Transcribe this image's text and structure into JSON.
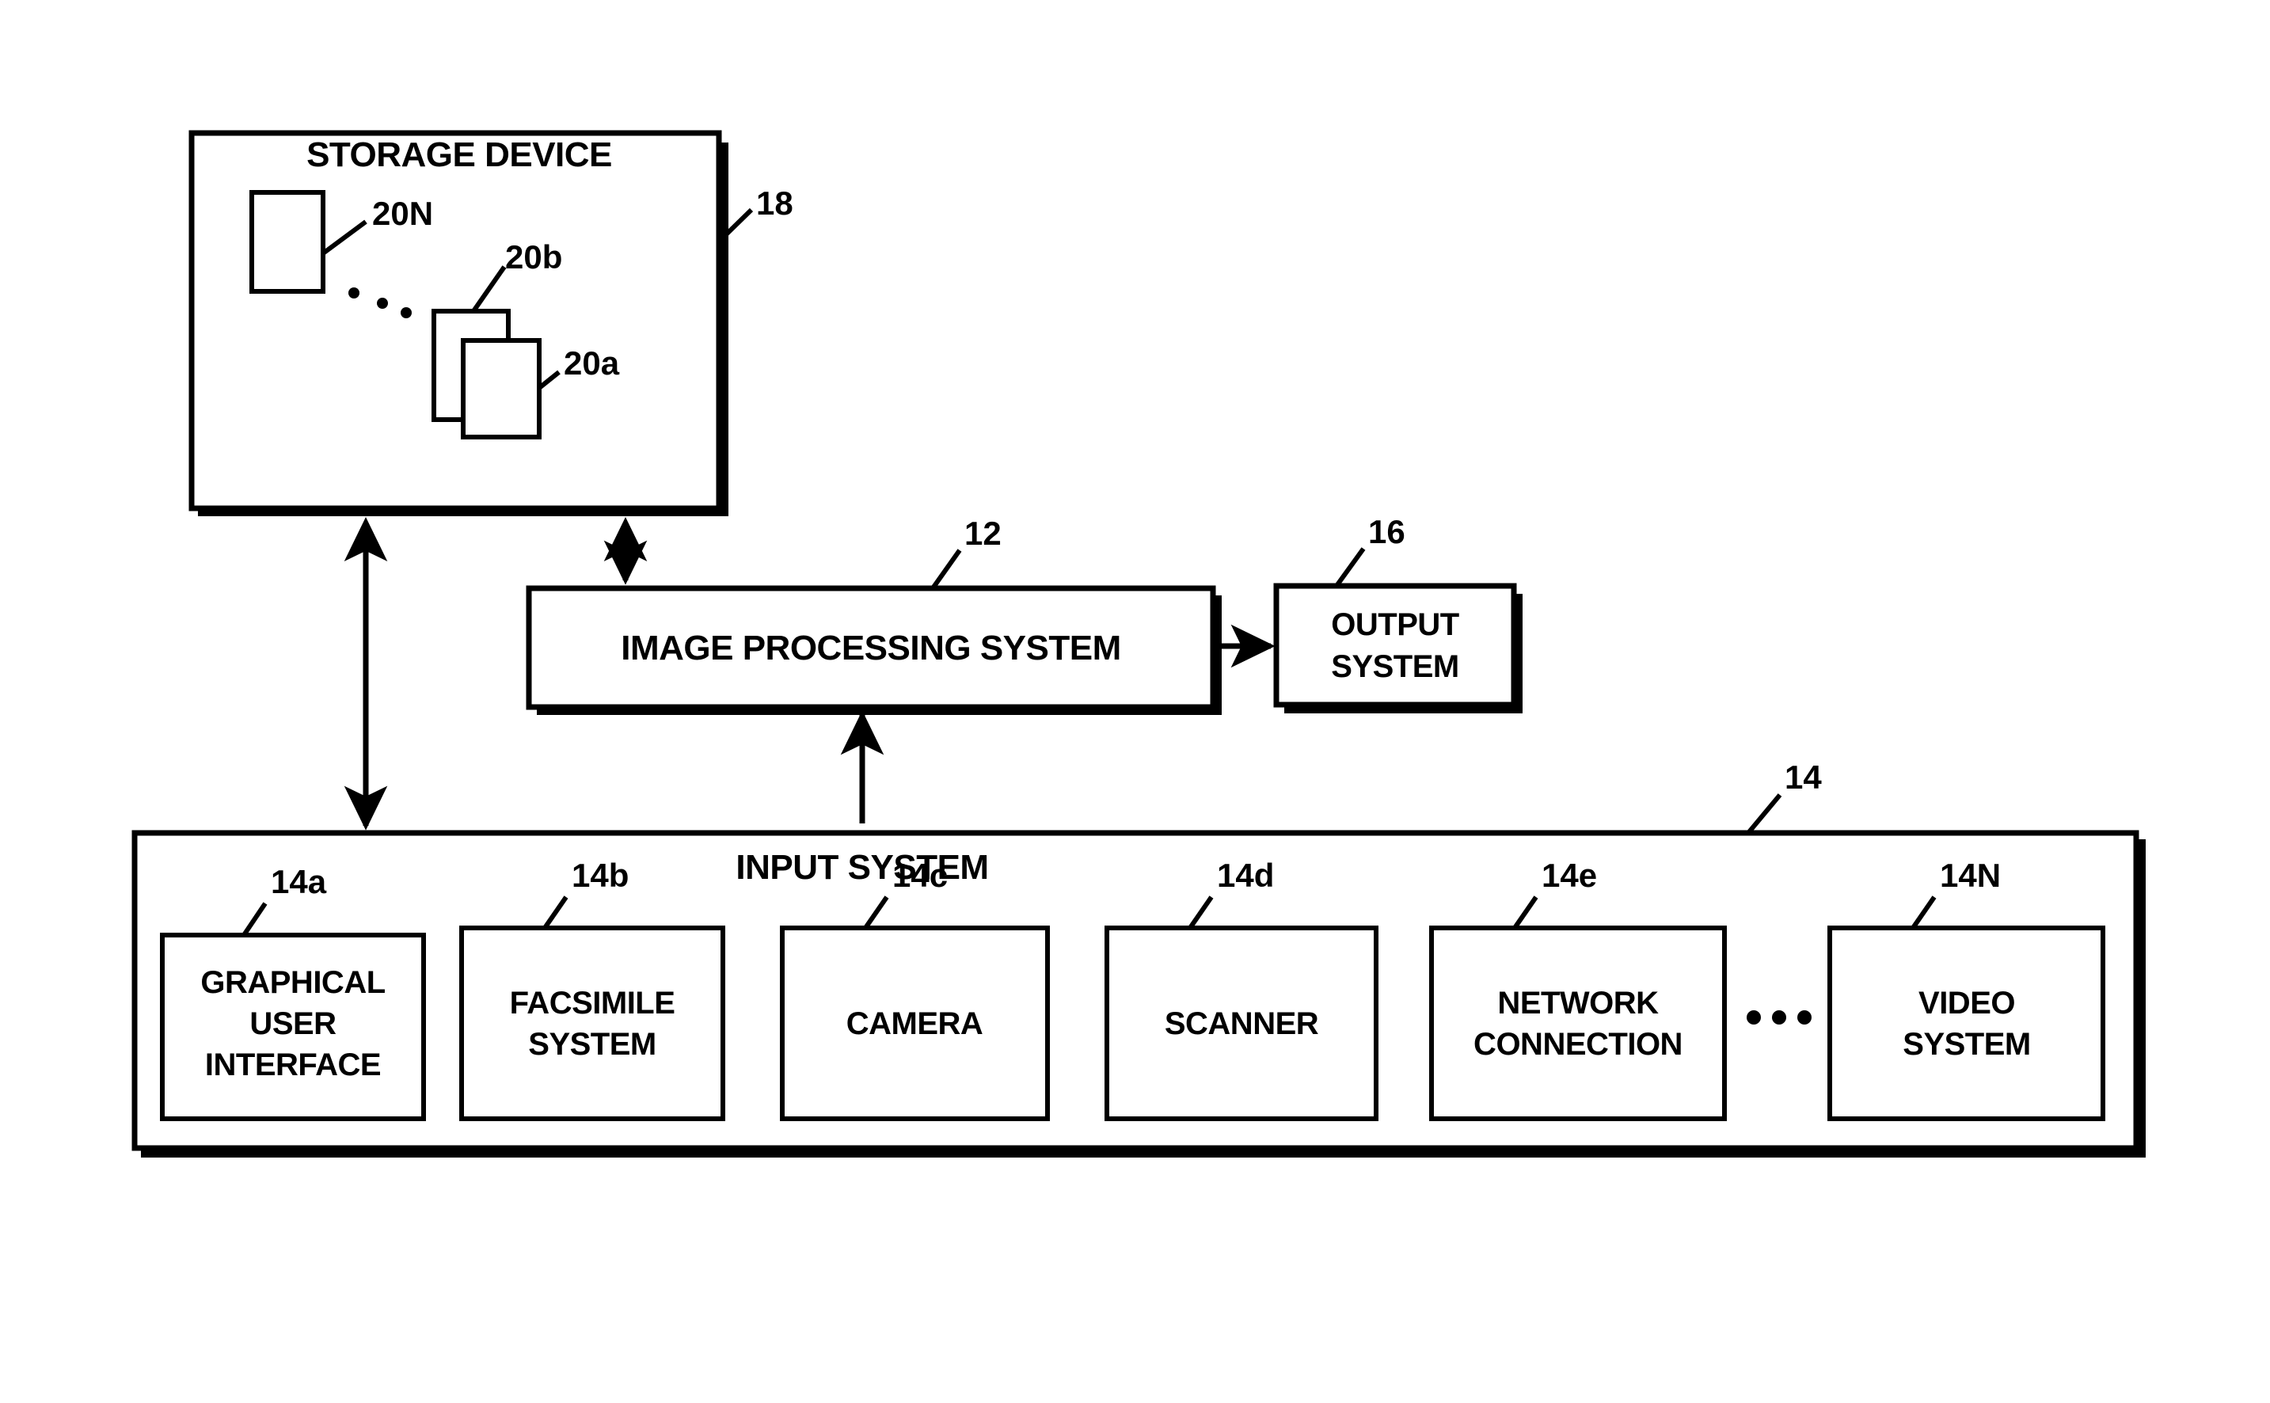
{
  "figure": {
    "type": "patent-block-diagram",
    "background_color": "#ffffff",
    "line_color": "#000000"
  },
  "storage": {
    "title": "STORAGE DEVICE",
    "ref": "18",
    "documents": [
      {
        "label": "20N"
      },
      {
        "label": "20b"
      },
      {
        "label": "20a"
      }
    ],
    "ellipsis": "..."
  },
  "processing": {
    "title": "IMAGE PROCESSING SYSTEM",
    "ref": "12"
  },
  "output": {
    "title_line1": "OUTPUT",
    "title_line2": "SYSTEM",
    "ref": "16"
  },
  "input": {
    "title": "INPUT SYSTEM",
    "ref": "14",
    "ellipsis": "...",
    "items": [
      {
        "ref": "14a",
        "label_line1": "GRAPHICAL",
        "label_line2": "USER",
        "label_line3": "INTERFACE"
      },
      {
        "ref": "14b",
        "label_line1": "FACSIMILE",
        "label_line2": "SYSTEM",
        "label_line3": ""
      },
      {
        "ref": "14c",
        "label_line1": "CAMERA",
        "label_line2": "",
        "label_line3": ""
      },
      {
        "ref": "14d",
        "label_line1": "SCANNER",
        "label_line2": "",
        "label_line3": ""
      },
      {
        "ref": "14e",
        "label_line1": "NETWORK",
        "label_line2": "CONNECTION",
        "label_line3": ""
      },
      {
        "ref": "14N",
        "label_line1": "VIDEO",
        "label_line2": "SYSTEM",
        "label_line3": ""
      }
    ]
  }
}
